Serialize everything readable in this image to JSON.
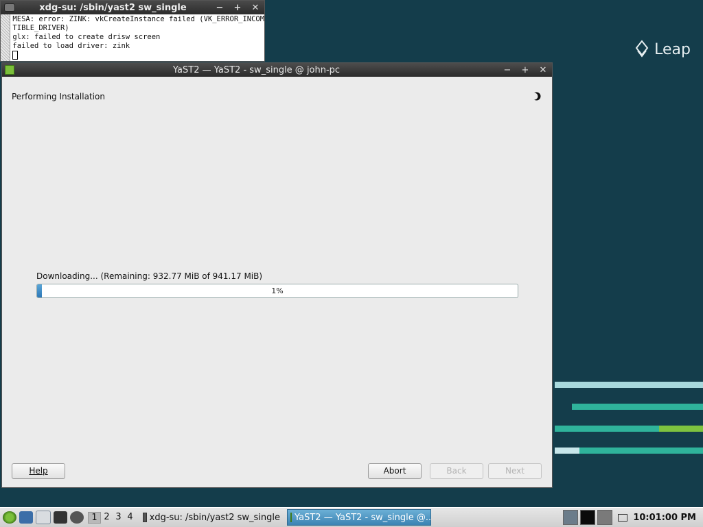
{
  "desktop": {
    "logo_text": "Leap",
    "stripe_colors": [
      "#a8d8dc",
      "#2fb39b",
      "#2fb39b",
      "#7ec33f",
      "#c7e6ea",
      "#2fb39b"
    ]
  },
  "terminal": {
    "title": "xdg-su: /sbin/yast2 sw_single",
    "lines": [
      "MESA: error: ZINK: vkCreateInstance failed (VK_ERROR_INCOMPA",
      "TIBLE_DRIVER)",
      "glx: failed to create drisw screen",
      "failed to load driver: zink"
    ],
    "controls": {
      "minimize": "−",
      "maximize": "+",
      "close": "✕"
    }
  },
  "yast": {
    "title": "YaST2 — YaST2 - sw_single @ john-pc",
    "controls": {
      "minimize": "−",
      "maximize": "+",
      "close": "✕"
    },
    "heading": "Performing Installation",
    "download_label": "Downloading... (Remaining: 932.77 MiB of 941.17 MiB)",
    "progress_value": 0.01,
    "progress_text": "1%",
    "buttons": {
      "help": "Help",
      "abort": "Abort",
      "back": "Back",
      "next": "Next"
    }
  },
  "taskbar": {
    "workspaces": [
      "1",
      "2",
      "3",
      "4"
    ],
    "active_workspace": "1",
    "tasks": [
      {
        "label": "xdg-su: /sbin/yast2 sw_single",
        "active": false
      },
      {
        "label": "YaST2 — YaST2 - sw_single @...",
        "active": true
      }
    ],
    "clock": "10:01:00 PM",
    "icons": [
      "opensuse-menu-icon",
      "desktop-icon",
      "file-manager-icon",
      "terminal-icon",
      "browser-icon"
    ]
  }
}
